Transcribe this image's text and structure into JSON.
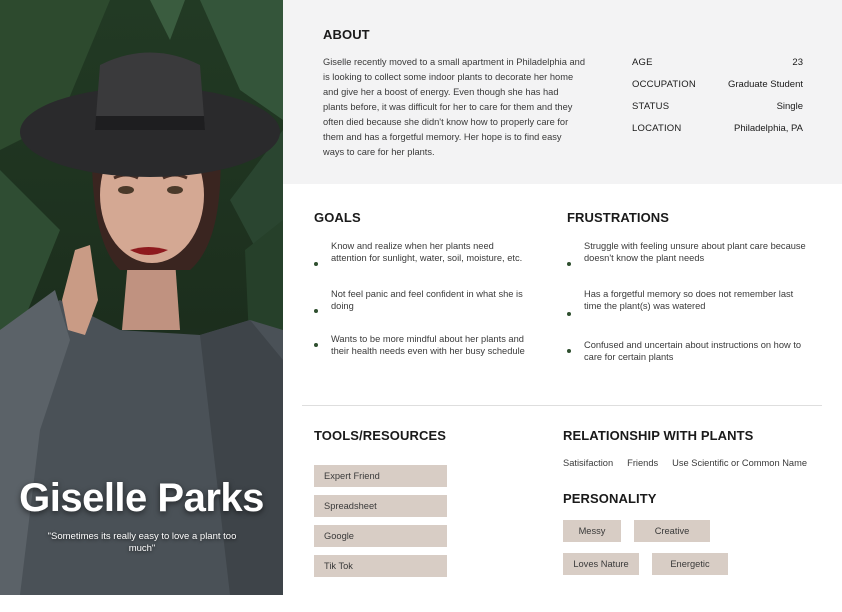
{
  "persona": {
    "name": "Giselle Parks",
    "quote": "\"Sometimes its really easy to love a plant too much\""
  },
  "about": {
    "title": "ABOUT",
    "text": "Giselle recently moved to a small apartment in Philadelphia and is looking to collect some indoor plants to decorate her home and give her a boost of energy. Even though she has had plants before, it was difficult for her to care for them and they often died because she didn't know how to properly care for them and has a forgetful memory. Her hope is to find easy ways to care for her plants.",
    "facts": [
      {
        "label": "AGE",
        "value": "23"
      },
      {
        "label": "OCCUPATION",
        "value": "Graduate Student"
      },
      {
        "label": "STATUS",
        "value": "Single"
      },
      {
        "label": "LOCATION",
        "value": "Philadelphia, PA"
      }
    ]
  },
  "goals": {
    "title": "GOALS",
    "items": [
      "Know and realize when her plants need attention for sunlight, water, soil, moisture, etc.",
      "Not feel panic and feel confident in what she is doing",
      "Wants to be more mindful about her plants and their health needs even with her busy schedule"
    ]
  },
  "frustrations": {
    "title": "FRUSTRATIONS",
    "items": [
      "Struggle with feeling unsure about plant care because doesn't know the plant needs",
      "Has a forgetful memory so does not remember last time the plant(s) was watered",
      "Confused and uncertain about instructions on how to care for certain plants"
    ]
  },
  "tools": {
    "title": "TOOLS/RESOURCES",
    "items": [
      "Expert Friend",
      "Spreadsheet",
      "Google",
      "Tik Tok"
    ]
  },
  "relationship": {
    "title": "RELATIONSHIP WITH PLANTS",
    "labels": [
      "Satisifaction",
      "Friends",
      "Use Scientific or Common Name"
    ]
  },
  "personality": {
    "title": "PERSONALITY",
    "traits": [
      "Messy",
      "Creative",
      "Loves Nature",
      "Energetic"
    ]
  },
  "colors": {
    "about_bg": "#f3f3f4",
    "chip": "#d8cdc5",
    "bullet": "#2f4f2f",
    "foliage": "#223a24"
  }
}
